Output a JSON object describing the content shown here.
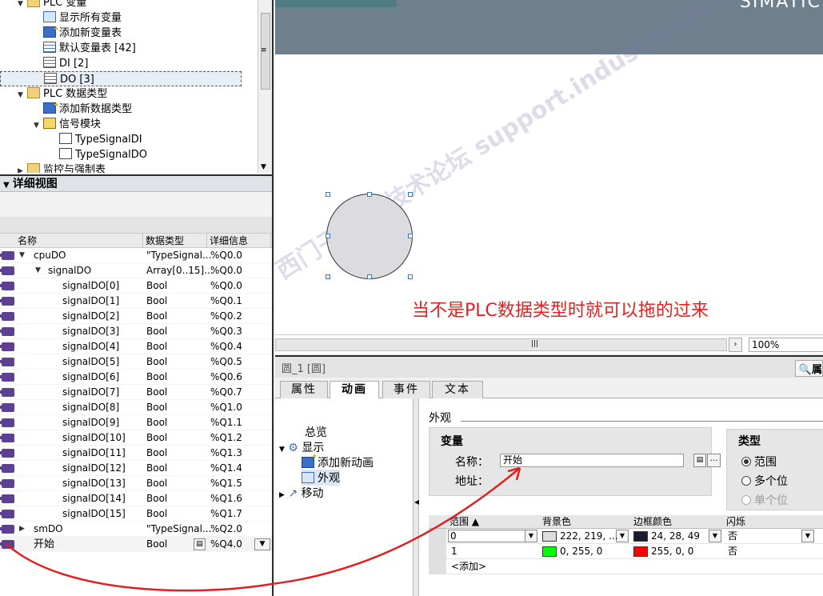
{
  "project_tree": {
    "items": [
      {
        "label": "PLC 变量",
        "indent": 1,
        "arrow": "▼",
        "icon": "i-folder"
      },
      {
        "label": "显示所有变量",
        "indent": 2,
        "icon": "i-show"
      },
      {
        "label": "添加新变量表",
        "indent": 2,
        "icon": "i-add"
      },
      {
        "label": "默认变量表 [42]",
        "indent": 2,
        "icon": "i-table"
      },
      {
        "label": "DI [2]",
        "indent": 2,
        "icon": "i-table"
      },
      {
        "label": "DO [3]",
        "indent": 2,
        "icon": "i-table",
        "selected": true
      },
      {
        "label": "PLC 数据类型",
        "indent": 1,
        "arrow": "▼",
        "icon": "i-folder"
      },
      {
        "label": "添加新数据类型",
        "indent": 2,
        "icon": "i-add"
      },
      {
        "label": "信号模块",
        "indent": 2,
        "arrow": "▼",
        "icon": "i-sig"
      },
      {
        "label": "TypeSignalDI",
        "indent": 3,
        "icon": "i-type"
      },
      {
        "label": "TypeSignalDO",
        "indent": 3,
        "icon": "i-type"
      },
      {
        "label": "监控与强制表",
        "indent": 1,
        "arrow": "▶",
        "icon": "i-folder"
      }
    ]
  },
  "detail_view": {
    "title": "详细视图",
    "columns": {
      "name": "名称",
      "type": "数据类型",
      "detail": "详细信息"
    },
    "rows": [
      {
        "name": "cpuDO",
        "type": "\"TypeSignal...",
        "detail": "%Q0.0",
        "indent": 0,
        "arrow": "▼"
      },
      {
        "name": "signalDO",
        "type": "Array[0..15]...",
        "detail": "%Q0.0",
        "indent": 1,
        "arrow": "▼"
      },
      {
        "name": "signalDO[0]",
        "type": "Bool",
        "detail": "%Q0.0",
        "indent": 2
      },
      {
        "name": "signalDO[1]",
        "type": "Bool",
        "detail": "%Q0.1",
        "indent": 2
      },
      {
        "name": "signalDO[2]",
        "type": "Bool",
        "detail": "%Q0.2",
        "indent": 2
      },
      {
        "name": "signalDO[3]",
        "type": "Bool",
        "detail": "%Q0.3",
        "indent": 2
      },
      {
        "name": "signalDO[4]",
        "type": "Bool",
        "detail": "%Q0.4",
        "indent": 2
      },
      {
        "name": "signalDO[5]",
        "type": "Bool",
        "detail": "%Q0.5",
        "indent": 2
      },
      {
        "name": "signalDO[6]",
        "type": "Bool",
        "detail": "%Q0.6",
        "indent": 2
      },
      {
        "name": "signalDO[7]",
        "type": "Bool",
        "detail": "%Q0.7",
        "indent": 2
      },
      {
        "name": "signalDO[8]",
        "type": "Bool",
        "detail": "%Q1.0",
        "indent": 2
      },
      {
        "name": "signalDO[9]",
        "type": "Bool",
        "detail": "%Q1.1",
        "indent": 2
      },
      {
        "name": "signalDO[10]",
        "type": "Bool",
        "detail": "%Q1.2",
        "indent": 2
      },
      {
        "name": "signalDO[11]",
        "type": "Bool",
        "detail": "%Q1.3",
        "indent": 2
      },
      {
        "name": "signalDO[12]",
        "type": "Bool",
        "detail": "%Q1.4",
        "indent": 2
      },
      {
        "name": "signalDO[13]",
        "type": "Bool",
        "detail": "%Q1.5",
        "indent": 2
      },
      {
        "name": "signalDO[14]",
        "type": "Bool",
        "detail": "%Q1.6",
        "indent": 2
      },
      {
        "name": "signalDO[15]",
        "type": "Bool",
        "detail": "%Q1.7",
        "indent": 2
      },
      {
        "name": "smDO",
        "type": "\"TypeSignal...",
        "detail": "%Q2.0",
        "indent": 0,
        "arrow": "▶"
      },
      {
        "name": "开始",
        "type": "Bool",
        "detail": "%Q4.0",
        "indent": 0,
        "editable": true
      }
    ]
  },
  "canvas": {
    "banner_logo": "SIMATIC",
    "annotation": "当不是PLC数据类型时就可以拖的过来",
    "watermark": "西门子工业 技术论坛  support.industry.siemens.com/cs",
    "zoom": "100%"
  },
  "properties": {
    "title": "圆_1 [圆]",
    "right_title": "属",
    "tabs": [
      {
        "label": "属性",
        "active": false
      },
      {
        "label": "动画",
        "active": true
      },
      {
        "label": "事件",
        "active": false
      },
      {
        "label": "文本",
        "active": false
      }
    ],
    "nav": {
      "overview": "总览",
      "display": "显示",
      "add_animation": "添加新动画",
      "appearance": "外观",
      "move": "移动"
    },
    "section_title": "外观",
    "variable_group": {
      "title": "变量",
      "name_label": "名称：",
      "name_value": "开始",
      "address_label": "地址："
    },
    "type_group": {
      "title": "类型",
      "options": [
        {
          "label": "范围",
          "checked": true,
          "disabled": false
        },
        {
          "label": "多个位",
          "checked": false,
          "disabled": false
        },
        {
          "label": "单个位",
          "checked": false,
          "disabled": true
        }
      ]
    },
    "range_table": {
      "columns": {
        "range": "范围 ▲",
        "bg": "背景色",
        "border": "边框颜色",
        "flash": "闪烁"
      },
      "rows": [
        {
          "range": "0",
          "bg": "222, 219, ...",
          "bg_color": "#dedbe0",
          "border": "24, 28, 49",
          "border_color": "#181c31",
          "flash": "否"
        },
        {
          "range": "1",
          "bg": "0, 255, 0",
          "bg_color": "#00ff00",
          "border": "255, 0, 0",
          "border_color": "#ff0000",
          "flash": "否"
        }
      ],
      "add_row": "<添加>"
    }
  }
}
